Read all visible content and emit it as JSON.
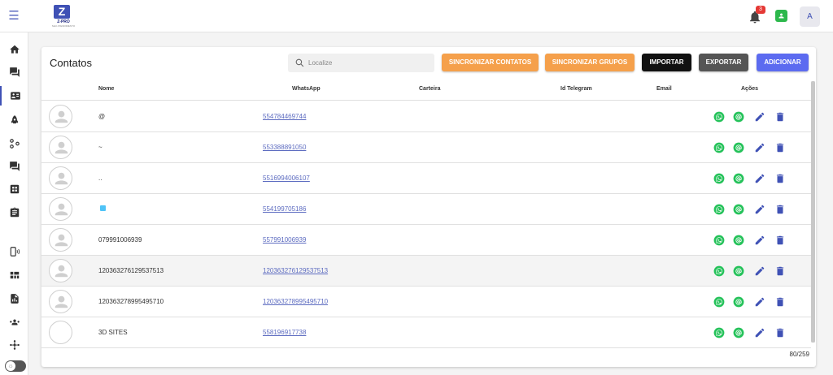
{
  "topbar": {
    "menu_icon": "hamburger-menu-icon",
    "logo": {
      "mark": "Z",
      "name": "Z-PRO",
      "subtitle": "SEU ATENDIMENTO"
    },
    "notification_count": "3",
    "avatar_initial": "A",
    "colors": {
      "accent": "#3f51b5",
      "badge": "#e53935",
      "user_status": "#2db84c"
    }
  },
  "sidebar": {
    "items": [
      {
        "icon": "home-icon"
      },
      {
        "icon": "chats-icon"
      },
      {
        "icon": "contacts-card-icon",
        "active": true
      },
      {
        "icon": "rocket-icon"
      },
      {
        "icon": "flow-icon"
      },
      {
        "icon": "forum-icon"
      },
      {
        "icon": "dashboard-icon"
      },
      {
        "icon": "clipboard-icon"
      },
      {
        "icon": "phone-signal-icon"
      },
      {
        "icon": "panels-icon"
      },
      {
        "icon": "report-icon"
      },
      {
        "icon": "group-icon"
      },
      {
        "icon": "api-icon"
      }
    ],
    "theme_toggle_icon": "sun-icon"
  },
  "contacts": {
    "title": "Contatos",
    "search_placeholder": "Localize",
    "buttons": {
      "sync_contacts": "SINCRONIZAR CONTATOS",
      "sync_groups": "SINCRONIZAR GRUPOS",
      "import": "IMPORTAR",
      "export": "EXPORTAR",
      "add": "ADICIONAR"
    },
    "button_colors": {
      "sync": "#f5a04b",
      "import": "#111111",
      "export": "#555555",
      "add": "#5c6bf0"
    },
    "columns": {
      "name": "Nome",
      "whatsapp": "WhatsApp",
      "wallet": "Carteira",
      "telegram": "Id Telegram",
      "email": "Email",
      "actions": "Ações"
    },
    "rows": [
      {
        "name": "@",
        "whatsapp": "554784469744",
        "avatar": "default"
      },
      {
        "name": "~",
        "whatsapp": "553388891050",
        "avatar": "default"
      },
      {
        "name": "..",
        "whatsapp": "5516994006107",
        "avatar": "default"
      },
      {
        "name": "",
        "whatsapp": "554199705186",
        "avatar": "default",
        "emoji_tile": true
      },
      {
        "name": "079991006939",
        "whatsapp": "557991006939",
        "avatar": "default"
      },
      {
        "name": "120363276129537513",
        "whatsapp": "120363276129537513",
        "avatar": "default",
        "highlighted": true
      },
      {
        "name": "120363278995495710",
        "whatsapp": "120363278995495710",
        "avatar": "default"
      },
      {
        "name": "3D SITES",
        "whatsapp": "558196917738",
        "avatar": "blank"
      }
    ],
    "row_action_icons": [
      "whatsapp-icon",
      "at-sign-icon",
      "edit-pencil-icon",
      "delete-trash-icon"
    ],
    "action_colors": {
      "whatsapp": "#25c25a",
      "edit": "#3f51b5",
      "delete": "#3f51b5"
    },
    "pagination": "80/259"
  }
}
